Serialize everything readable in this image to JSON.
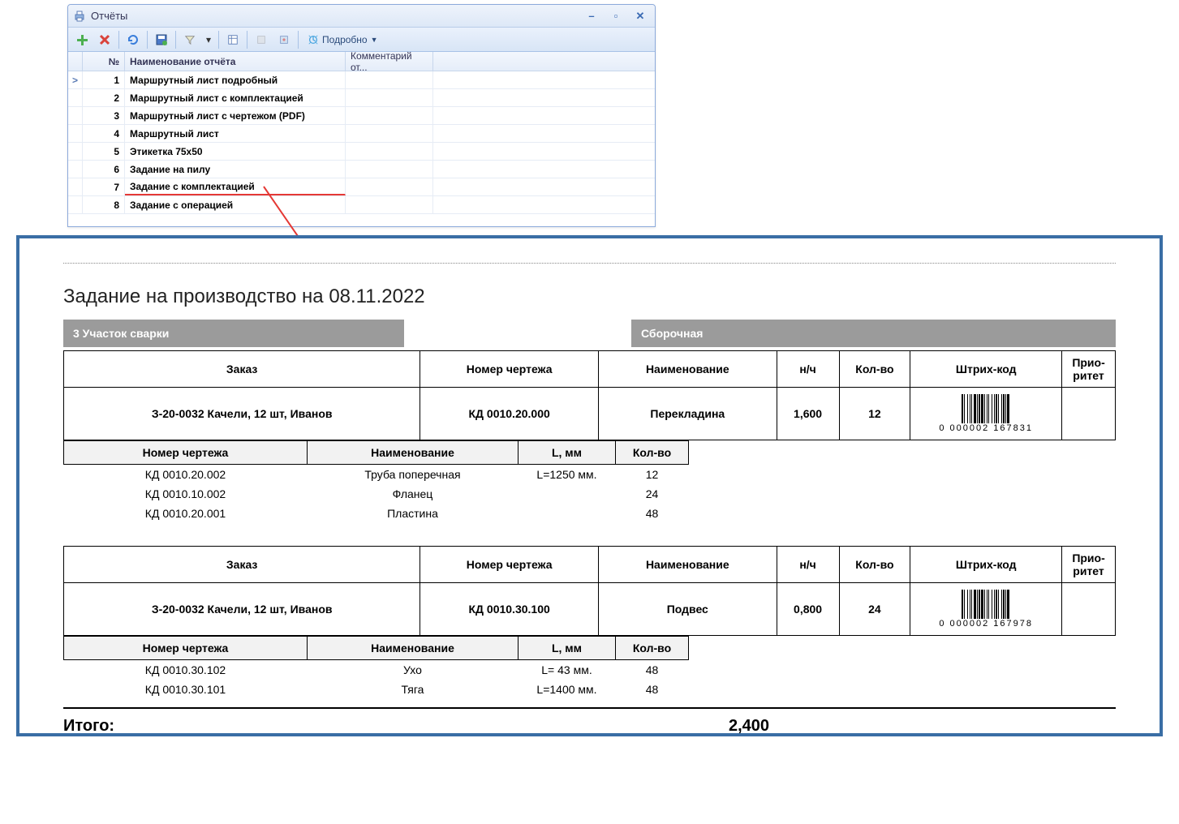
{
  "window": {
    "title": "Отчёты",
    "toolbar": {
      "more_label": "Подробно"
    },
    "grid": {
      "headers": {
        "num": "№",
        "name": "Наименование отчёта",
        "comment": "Комментарий от..."
      },
      "rows": [
        {
          "num": "1",
          "name": "Маршрутный лист подробный"
        },
        {
          "num": "2",
          "name": "Маршрутный лист с комплектацией"
        },
        {
          "num": "3",
          "name": "Маршрутный лист с чертежом (PDF)"
        },
        {
          "num": "4",
          "name": "Маршрутный лист"
        },
        {
          "num": "5",
          "name": "Этикетка 75х50"
        },
        {
          "num": "6",
          "name": "Задание на пилу"
        },
        {
          "num": "7",
          "name": "Задание с комплектацией"
        },
        {
          "num": "8",
          "name": "Задание с операцией"
        }
      ]
    }
  },
  "doc": {
    "title_prefix": "Задание на производство  на  ",
    "date": "08.11.2022",
    "section_left": "3 Участок  сварки",
    "section_right": "Сборочная",
    "headers": {
      "order": "Заказ",
      "drawing": "Номер чертежа",
      "name": "Наименование",
      "nh": "н/ч",
      "qty": "Кол-во",
      "barcode": "Штрих-код",
      "prio": "Прио-ритет",
      "lmm": "L, мм"
    },
    "jobs": [
      {
        "order": "З-20-0032 Качели, 12 шт, Иванов",
        "drawing": "КД 0010.20.000",
        "name": "Перекладина",
        "nh": "1,600",
        "qty": "12",
        "barcode_text": "0   000002    167831",
        "components": [
          {
            "drawing": "КД 0010.20.002",
            "name": "Труба поперечная",
            "l": "L=1250 мм.",
            "qty": "12"
          },
          {
            "drawing": "КД 0010.10.002",
            "name": "Фланец",
            "l": "",
            "qty": "24"
          },
          {
            "drawing": "КД 0010.20.001",
            "name": "Пластина",
            "l": "",
            "qty": "48"
          }
        ]
      },
      {
        "order": "З-20-0032 Качели, 12 шт, Иванов",
        "drawing": "КД 0010.30.100",
        "name": "Подвес",
        "nh": "0,800",
        "qty": "24",
        "barcode_text": "0   000002    167978",
        "components": [
          {
            "drawing": "КД 0010.30.102",
            "name": "Ухо",
            "l": "L= 43 мм.",
            "qty": "48"
          },
          {
            "drawing": "КД 0010.30.101",
            "name": "Тяга",
            "l": "L=1400 мм.",
            "qty": "48"
          }
        ]
      }
    ],
    "total_label": "Итого:",
    "total_value": "2,400"
  }
}
